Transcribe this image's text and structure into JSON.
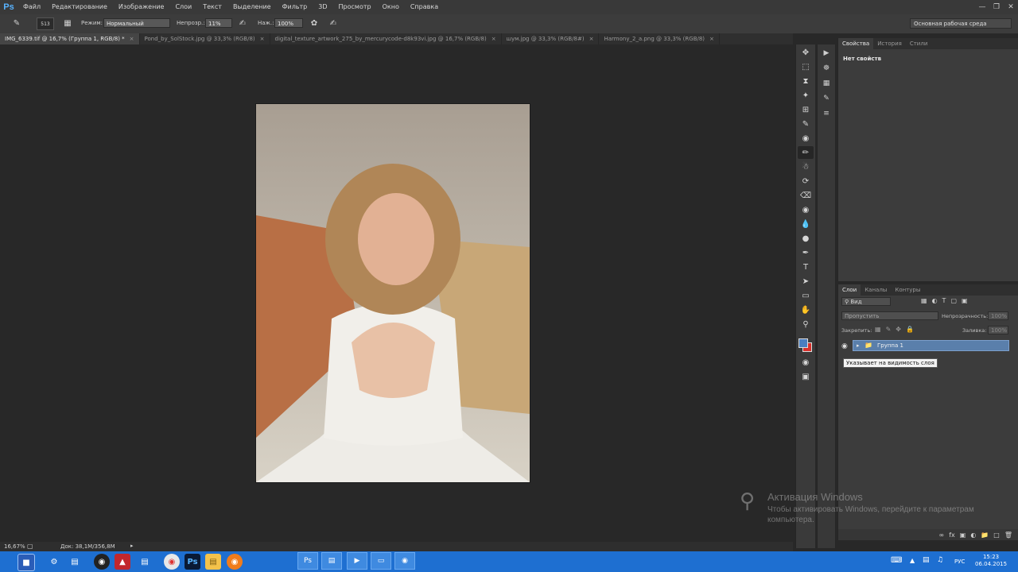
{
  "app": {
    "logo": "Ps"
  },
  "menu": [
    "Файл",
    "Редактирование",
    "Изображение",
    "Слои",
    "Текст",
    "Выделение",
    "Фильтр",
    "3D",
    "Просмотр",
    "Окно",
    "Справка"
  ],
  "options_bar": {
    "brush_size": "513",
    "mode_label": "Режим:",
    "mode_value": "Нормальный",
    "opacity_label": "Непрозр.:",
    "opacity_value": "11%",
    "pressure_label": "Наж.:",
    "pressure_value": "100%",
    "workspace": "Основная рабочая среда"
  },
  "tabs": [
    {
      "label": "IMG_6339.tif @ 16,7% (Группа 1, RGB/8) *",
      "active": true
    },
    {
      "label": "Pond_by_SolStock.jpg @ 33,3% (RGB/8)",
      "active": false
    },
    {
      "label": "digital_texture_artwork_275_by_mercurycode-d8k93vi.jpg @ 16,7% (RGB/8)",
      "active": false
    },
    {
      "label": "шум.jpg @ 33,3% (RGB/8#)",
      "active": false
    },
    {
      "label": "Harmony_2_a.png @ 33,3% (RGB/8)",
      "active": false
    }
  ],
  "status": {
    "zoom": "16,67%",
    "doc_size": "Док: 38,1M/356,8M"
  },
  "properties_panel": {
    "tabs": [
      "Свойства",
      "История",
      "Стили"
    ],
    "active_tab": "Свойства",
    "empty_text": "Нет свойств"
  },
  "layers_panel": {
    "tabs": [
      "Слои",
      "Каналы",
      "Контуры"
    ],
    "active_tab": "Слои",
    "filter_value": "Вид",
    "blend_mode": "Пропустить",
    "opacity_label": "Непрозрачность:",
    "opacity_value": "100%",
    "lock_label": "Закрепить:",
    "fill_label": "Заливка:",
    "fill_value": "100%",
    "group_name": "Группа 1",
    "tooltip": "Указывает на видимость слоя"
  },
  "watermark": {
    "title": "Активация Windows",
    "text": "Чтобы активировать Windows, перейдите к параметрам компьютера."
  },
  "taskbar": {
    "language": "РУС",
    "time": "15:23",
    "date": "06.04.2015"
  },
  "colors": {
    "accent": "#58b3ff",
    "foreground_swatch": "#4a7fc1",
    "background_swatch": "#d8302b",
    "taskbar": "#1e6fd1",
    "selected_layer": "#5a7fab"
  }
}
